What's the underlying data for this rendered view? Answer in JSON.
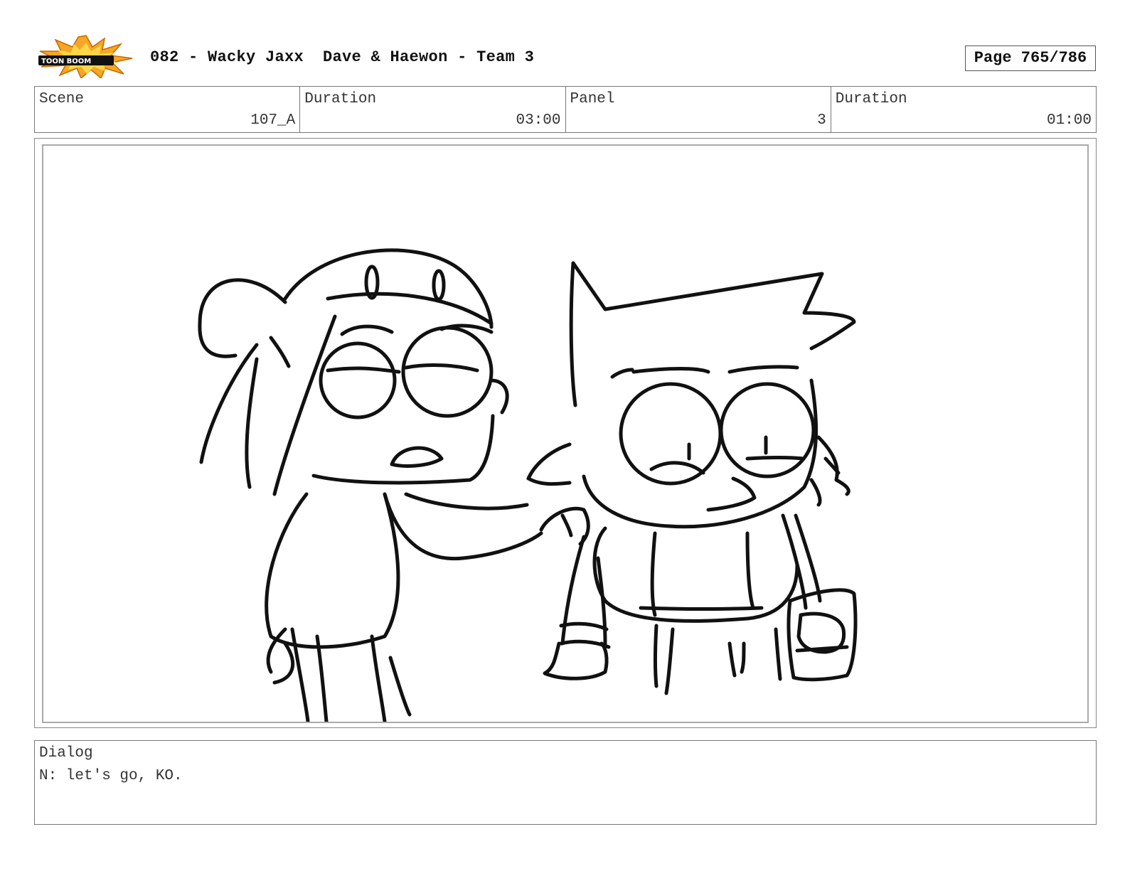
{
  "header": {
    "logo_alt": "TOON BOOM",
    "title": "082 - Wacky Jaxx  Dave & Haewon - Team 3",
    "page": "Page 765/786"
  },
  "info": {
    "scene_label": "Scene",
    "scene_value": "107_A",
    "scene_duration_label": "Duration",
    "scene_duration_value": "03:00",
    "panel_label": "Panel",
    "panel_value": "3",
    "panel_duration_label": "Duration",
    "panel_duration_value": "01:00"
  },
  "dialog": {
    "label": "Dialog",
    "text": "N: let's go, KO."
  },
  "colors": {
    "logo_burst": "#f5a623",
    "logo_inner": "#ffd54a",
    "logo_band": "#111111"
  }
}
